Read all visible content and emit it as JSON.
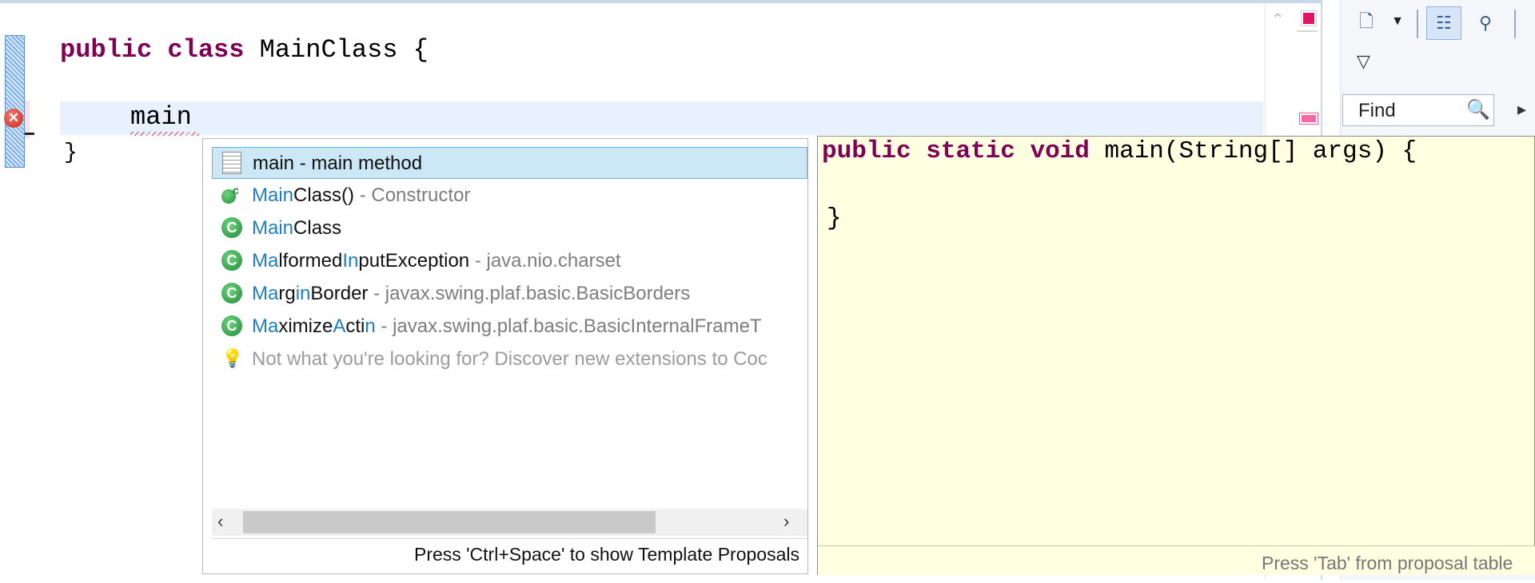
{
  "editor": {
    "line1": {
      "kw1": "public",
      "kw2": "class",
      "rest": " MainClass {"
    },
    "line2": {
      "text": "main"
    },
    "line3": {
      "text": "}"
    },
    "error_marker": "✕"
  },
  "side_panel": {
    "find_label": "Find"
  },
  "content_assist": {
    "proposals": [
      {
        "segments": [
          {
            "text": "main - main method",
            "style": "normal"
          }
        ],
        "icon": "template-icon",
        "selected": true
      },
      {
        "segments": [
          {
            "text": "Main",
            "style": "hl"
          },
          {
            "text": "Class()",
            "style": "normal"
          },
          {
            "text": " - Constructor",
            "style": "qual"
          }
        ],
        "icon": "constructor-icon",
        "selected": false
      },
      {
        "segments": [
          {
            "text": "Main",
            "style": "hl"
          },
          {
            "text": "Class",
            "style": "normal"
          }
        ],
        "icon": "class-icon",
        "selected": false
      },
      {
        "segments": [
          {
            "text": "Ma",
            "style": "hl"
          },
          {
            "text": "lformed",
            "style": "normal"
          },
          {
            "text": "In",
            "style": "hl"
          },
          {
            "text": "putException",
            "style": "normal"
          },
          {
            "text": " - java.nio.charset",
            "style": "qual"
          }
        ],
        "icon": "class-icon",
        "selected": false
      },
      {
        "segments": [
          {
            "text": "Ma",
            "style": "hl"
          },
          {
            "text": "rg",
            "style": "normal"
          },
          {
            "text": "in",
            "style": "hl"
          },
          {
            "text": "Border",
            "style": "normal"
          },
          {
            "text": " - javax.swing.plaf.basic.BasicBorders",
            "style": "qual"
          }
        ],
        "icon": "class-icon",
        "selected": false
      },
      {
        "segments": [
          {
            "text": "Ma",
            "style": "hl"
          },
          {
            "text": "ximize",
            "style": "normal"
          },
          {
            "text": "A",
            "style": "hl"
          },
          {
            "text": "cti",
            "style": "normal"
          },
          {
            "text": "n",
            "style": "hl"
          },
          {
            "text": " - javax.swing.plaf.basic.BasicInternalFrameT",
            "style": "qual"
          }
        ],
        "icon": "class-icon",
        "selected": false
      },
      {
        "segments": [
          {
            "text": "Not what you're looking for? Discover new extensions to Coc",
            "style": "hint"
          }
        ],
        "icon": "lightbulb-icon",
        "selected": false
      }
    ],
    "status": "Press 'Ctrl+Space' to show Template Proposals"
  },
  "doc_popup": {
    "line1": {
      "kw1": "public",
      "kw2": "static",
      "kw3": "void",
      "rest": " main(String[] args) {"
    },
    "line2": "}",
    "status": "Press 'Tab' from proposal table"
  },
  "colors": {
    "keyword": "#7f0055",
    "highlight": "#1f7ec2",
    "qualifier": "#7d7d7d",
    "selection": "#cce8f6",
    "doc_background": "#ffffe1"
  }
}
